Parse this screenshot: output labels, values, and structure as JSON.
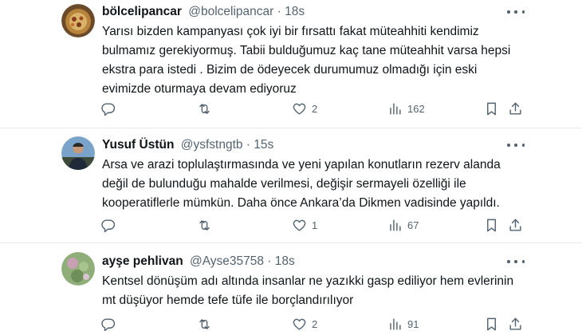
{
  "tweets": [
    {
      "name": "bölcelipancar",
      "handle": "@bolcelipancar",
      "separator": "·",
      "time": "18s",
      "text": "Yarısı bizden kampanyası çok iyi bir fırsattı fakat müteahhiti kendimiz\nbulmamız gerekiyormuş. Tabii bulduğumuz kaç tane müteahhit varsa hepsi\nekstra para istedi . Bizim de ödeyecek durumumuz olmadığı için eski\nevimizde oturmaya devam ediyoruz",
      "likes": "2",
      "views": "162"
    },
    {
      "name": "Yusuf Üstün",
      "handle": "@ysfstngtb",
      "separator": "·",
      "time": "15s",
      "text": "Arsa ve arazi toplulaştırmasında ve yeni yapılan konutların rezerv alanda\ndeğil de bulunduğu mahalde verilmesi, değişir sermayeli özelliği ile\nkooperatiflerle mümkün. Daha önce Ankara’da Dikmen vadisinde yapıldı.",
      "likes": "1",
      "views": "67"
    },
    {
      "name": "ayşe pehlivan",
      "handle": "@Ayse35758",
      "separator": "·",
      "time": "18s",
      "text": "Kentsel dönüşüm adı altında insanlar ne yazıkki gasp ediliyor hem evlerinin\nmt düşüyor hemde tefe tüfe ile borçlandırılıyor",
      "likes": "2",
      "views": "91"
    }
  ],
  "icons": {
    "reply": "reply-icon",
    "retweet": "retweet-icon",
    "like": "heart-icon",
    "views": "views-icon",
    "bookmark": "bookmark-icon",
    "share": "share-icon",
    "more": "more-icon"
  },
  "colors": {
    "text": "#0f1419",
    "secondary": "#536471",
    "divider": "#e7e9ea"
  }
}
